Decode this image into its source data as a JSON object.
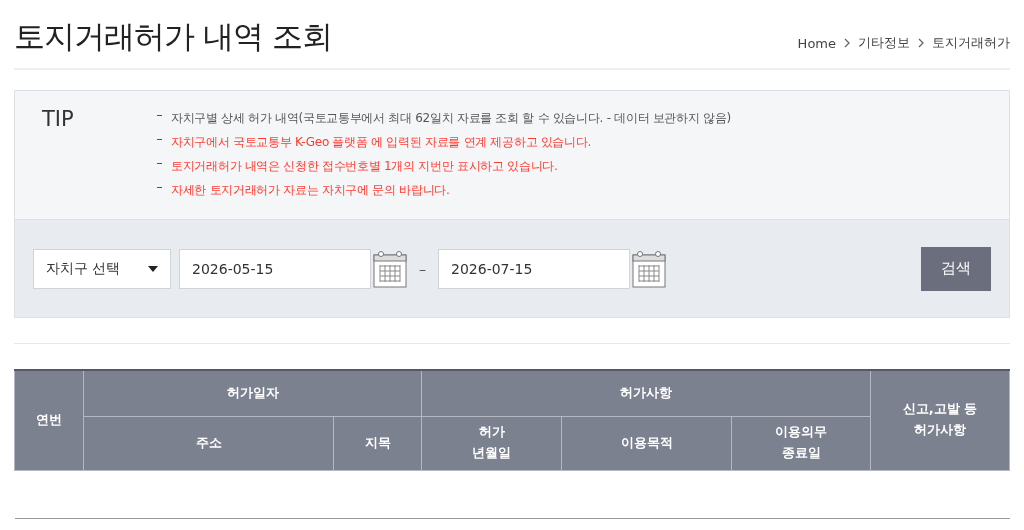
{
  "page_title": "토지거래허가 내역 조회",
  "breadcrumb": [
    "Home",
    "기타정보",
    "토지거래허가"
  ],
  "tip": {
    "heading": "TIP",
    "items": [
      {
        "text": "자치구별 상세 허가 내역(국토교통부에서 최대 62일치 자료를 조회 할 수 있습니다. - 데이터 보관하지 않음)",
        "color": "#555555"
      },
      {
        "text": "자치구에서 국토교통부 K-Geo 플랫폼 에 입력된 자료를 연계 제공하고 있습니다.",
        "color": "#ff3b30"
      },
      {
        "text": "토지거래허가 내역은 신청한 접수번호별 1개의 지번만 표시하고 있습니다.",
        "color": "#ff3b30"
      },
      {
        "text": "자세한 토지거래허가 자료는 자치구에 문의 바랍니다.",
        "color": "#ff3b30"
      }
    ]
  },
  "search": {
    "district_select": "자치구 선택",
    "start_date": "2026-05-15",
    "separator": "–",
    "end_date": "2026-07-15",
    "button": "검색"
  },
  "table": {
    "columns": [
      {
        "label": "연번"
      },
      {
        "label": "허가일자",
        "children": [
          {
            "label": "주소"
          },
          {
            "label": "지목"
          }
        ]
      },
      {
        "label": "허가사항",
        "children": [
          {
            "label": "허가\n년월일"
          },
          {
            "label": "이용목적"
          },
          {
            "label": "이용의무\n종료일"
          }
        ]
      },
      {
        "label": "신고,고발 등\n허가사항"
      }
    ]
  }
}
